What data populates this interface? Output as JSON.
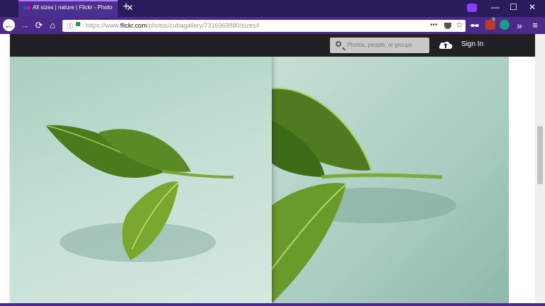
{
  "window": {
    "tab_title": "All sizes | nature | Flickr - Photo",
    "close_glyph": "✕",
    "newtab_glyph": "+",
    "min_glyph": "—",
    "max_glyph": "☐",
    "winclose_glyph": "✕"
  },
  "nav": {
    "back_glyph": "←",
    "forward_glyph": "→",
    "reload_glyph": "⟳",
    "home_glyph": "⌂",
    "info_glyph": "ⓘ",
    "url_prefix": "https://www.",
    "url_domain": "flickr.com",
    "url_path": "/photos/cubagallery/7316969880/sizes/l",
    "more_glyph": "•••",
    "star_glyph": "☆",
    "ext_badge": "6",
    "overflow_glyph": "»",
    "menu_glyph": "≡"
  },
  "header": {
    "search_placeholder": "Photos, people, or groups",
    "signin_label": "Sign In"
  },
  "colors": {
    "flickr_blue": "#0063dc",
    "flickr_pink": "#ff0084"
  }
}
